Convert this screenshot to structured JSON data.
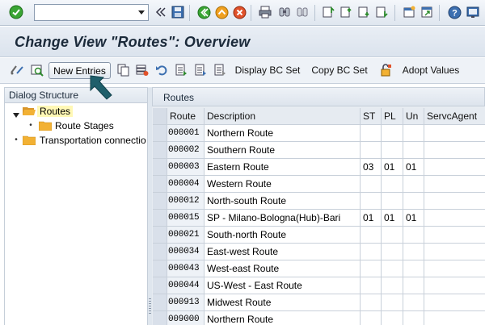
{
  "standard_toolbar": {
    "command_field": {
      "value": "",
      "placeholder": ""
    },
    "icons": [
      "enter-icon",
      "back-icon",
      "save-icon",
      "back-nav-icon",
      "exit-icon",
      "cancel-icon",
      "print-icon",
      "find-icon",
      "find-next-icon",
      "first-page-icon",
      "prev-page-icon",
      "next-page-icon",
      "last-page-icon",
      "new-session-icon",
      "shortcut-icon",
      "help-icon",
      "customize-layout-icon"
    ]
  },
  "title": "Change View \"Routes\": Overview",
  "app_toolbar": {
    "new_entries_label": "New Entries",
    "display_bc_set_label": "Display BC Set",
    "copy_bc_set_label": "Copy BC Set",
    "adopt_values_label": "Adopt Values"
  },
  "dialog_structure": {
    "header": "Dialog Structure",
    "items": [
      {
        "label": "Routes",
        "selected": true,
        "expanded": true
      },
      {
        "label": "Route Stages",
        "selected": false
      },
      {
        "label": "Transportation connectio",
        "selected": false
      }
    ]
  },
  "routes_table": {
    "title": "Routes",
    "columns": [
      "Route",
      "Description",
      "ST",
      "PL",
      "Un",
      "ServcAgent"
    ],
    "rows": [
      {
        "route": "000001",
        "description": "Northern Route",
        "st": "",
        "pl": "",
        "un": "",
        "agent": ""
      },
      {
        "route": "000002",
        "description": "Southern Route",
        "st": "",
        "pl": "",
        "un": "",
        "agent": ""
      },
      {
        "route": "000003",
        "description": "Eastern Route",
        "st": "03",
        "pl": "01",
        "un": "01",
        "agent": ""
      },
      {
        "route": "000004",
        "description": "Western Route",
        "st": "",
        "pl": "",
        "un": "",
        "agent": ""
      },
      {
        "route": "000012",
        "description": "North-south Route",
        "st": "",
        "pl": "",
        "un": "",
        "agent": ""
      },
      {
        "route": "000015",
        "description": "SP - Milano-Bologna(Hub)-Bari",
        "st": "01",
        "pl": "01",
        "un": "01",
        "agent": ""
      },
      {
        "route": "000021",
        "description": "South-north Route",
        "st": "",
        "pl": "",
        "un": "",
        "agent": ""
      },
      {
        "route": "000034",
        "description": "East-west Route",
        "st": "",
        "pl": "",
        "un": "",
        "agent": ""
      },
      {
        "route": "000043",
        "description": "West-east Route",
        "st": "",
        "pl": "",
        "un": "",
        "agent": ""
      },
      {
        "route": "000044",
        "description": "US-West - East Route",
        "st": "",
        "pl": "",
        "un": "",
        "agent": ""
      },
      {
        "route": "000913",
        "description": "Midwest Route",
        "st": "",
        "pl": "",
        "un": "",
        "agent": ""
      },
      {
        "route": "009000",
        "description": "Northern Route",
        "st": "",
        "pl": "",
        "un": "",
        "agent": ""
      }
    ]
  },
  "colors": {
    "selected_tree_item": "#fff8b6",
    "folder": "#f2b134",
    "arrow": "#1f5f6b"
  }
}
